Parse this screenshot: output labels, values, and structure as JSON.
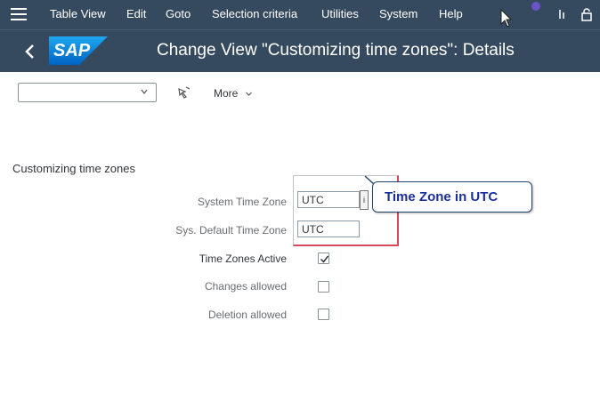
{
  "menubar": {
    "items": [
      "Table View",
      "Edit",
      "Goto",
      "Selection criteria",
      "Utilities",
      "System",
      "Help"
    ]
  },
  "titlebar": {
    "logo_text": "SAP",
    "title": "Change View \"Customizing time zones\": Details"
  },
  "toolbar": {
    "combo_value": "",
    "more_label": "More"
  },
  "section": {
    "title": "Customizing time zones"
  },
  "fields": {
    "system_time_zone": {
      "label": "System Time Zone",
      "value": "UTC"
    },
    "default_time_zone": {
      "label": "Sys. Default Time Zone",
      "value": "UTC"
    },
    "time_zones_active": {
      "label": "Time Zones Active",
      "checked": true
    },
    "changes_allowed": {
      "label": "Changes allowed",
      "checked": false
    },
    "deletion_allowed": {
      "label": "Deletion allowed",
      "checked": false
    }
  },
  "f4_label": "i",
  "callout": {
    "text": "Time Zone in UTC"
  },
  "colors": {
    "shell": "#354a5f",
    "callout_text": "#1a2f9a",
    "highlight_frame": "#d8485c"
  }
}
